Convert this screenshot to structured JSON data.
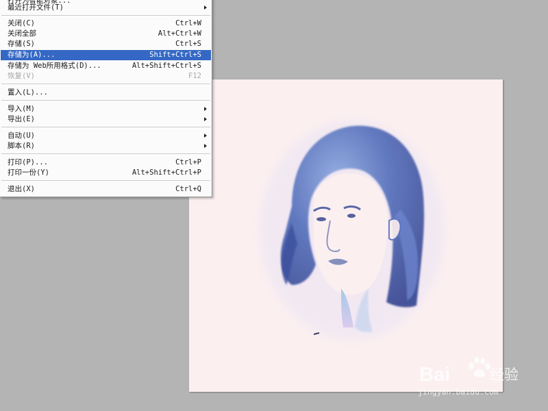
{
  "menu": {
    "items": [
      {
        "label": "打开为智能对象...",
        "shortcut": "",
        "submenu": false
      },
      {
        "label": "最近打开文件(T)",
        "shortcut": "",
        "submenu": true
      },
      {
        "label": "关闭(C)",
        "shortcut": "Ctrl+W",
        "submenu": false
      },
      {
        "label": "关闭全部",
        "shortcut": "Alt+Ctrl+W",
        "submenu": false
      },
      {
        "label": "存储(S)",
        "shortcut": "Ctrl+S",
        "submenu": false
      },
      {
        "label": "存储为(A)...",
        "shortcut": "Shift+Ctrl+S",
        "submenu": false,
        "highlighted": true
      },
      {
        "label": "存储为 Web所用格式(D)...",
        "shortcut": "Alt+Shift+Ctrl+S",
        "submenu": false
      },
      {
        "label": "恢复(V)",
        "shortcut": "F12",
        "submenu": false,
        "disabled": true
      },
      {
        "label": "置入(L)...",
        "shortcut": "",
        "submenu": false
      },
      {
        "label": "导入(M)",
        "shortcut": "",
        "submenu": true
      },
      {
        "label": "导出(E)",
        "shortcut": "",
        "submenu": true
      },
      {
        "label": "自动(U)",
        "shortcut": "",
        "submenu": true
      },
      {
        "label": "脚本(R)",
        "shortcut": "",
        "submenu": true
      },
      {
        "label": "打印(P)...",
        "shortcut": "Ctrl+P",
        "submenu": false
      },
      {
        "label": "打印一份(Y)",
        "shortcut": "Alt+Shift+Ctrl+P",
        "submenu": false
      },
      {
        "label": "退出(X)",
        "shortcut": "Ctrl+Q",
        "submenu": false
      }
    ]
  },
  "watermark": {
    "brand_left": "Bai",
    "brand_right": "经验",
    "url": "jingyan.baidu.com"
  },
  "colors": {
    "workspace": "#b4b4b4",
    "canvas": "#fbeff0",
    "menu_bg": "#fbfbfb",
    "highlight": "#3468c4",
    "hair_blue": "#3d5aa8"
  }
}
